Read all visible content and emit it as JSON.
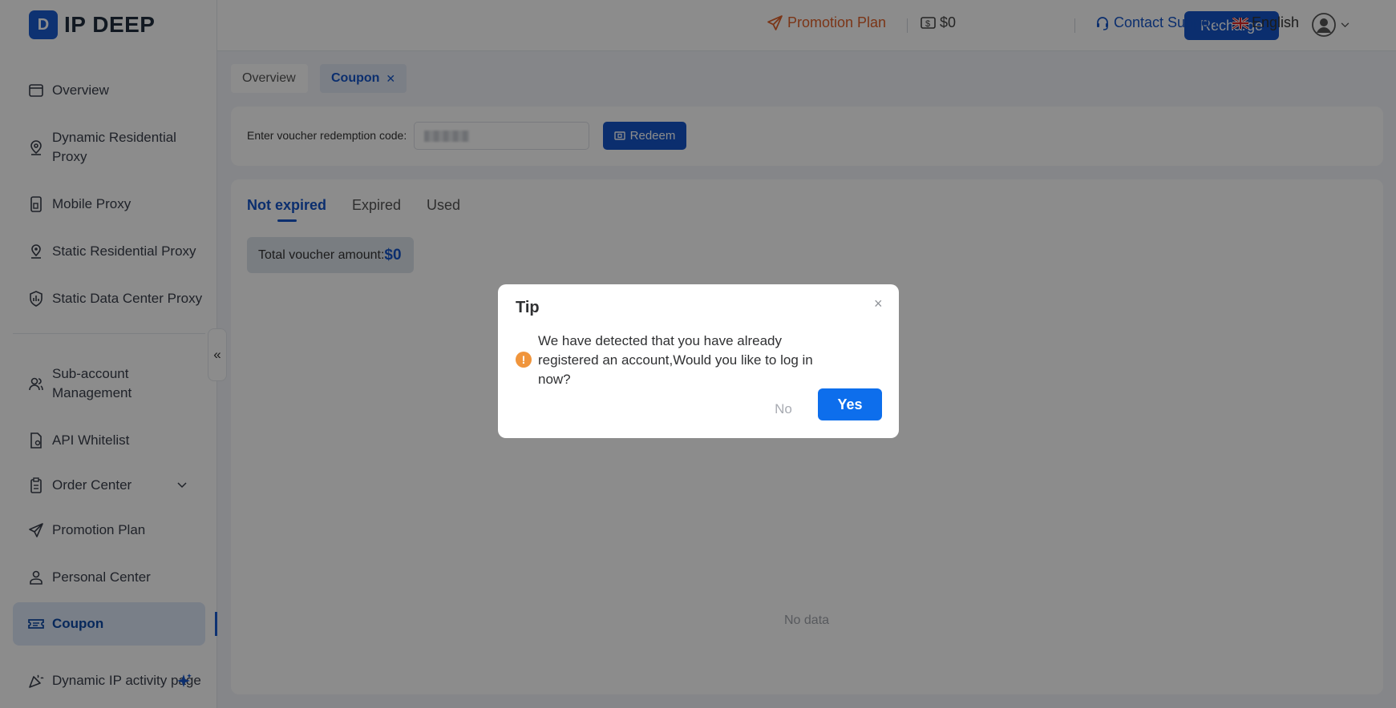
{
  "brand": {
    "logo_letter": "D",
    "name": "IP DEEP",
    "accent": "#1455c8"
  },
  "sidebar": {
    "items": [
      {
        "label": "Overview",
        "icon": "window-icon"
      },
      {
        "label": "Dynamic Residential Proxy",
        "icon": "location-pin-icon"
      },
      {
        "label": "Mobile Proxy",
        "icon": "mobile-icon"
      },
      {
        "label": "Static Residential Proxy",
        "icon": "pin-icon"
      },
      {
        "label": "Static Data Center Proxy",
        "icon": "shield-chart-icon"
      },
      {
        "label": "Sub-account Management",
        "icon": "users-icon"
      },
      {
        "label": "API Whitelist",
        "icon": "document-check-icon"
      },
      {
        "label": "Order Center",
        "icon": "clipboard-icon"
      },
      {
        "label": "Promotion Plan",
        "icon": "send-icon"
      },
      {
        "label": "Personal Center",
        "icon": "user-icon"
      },
      {
        "label": "Coupon",
        "icon": "ticket-icon"
      },
      {
        "label": "Dynamic IP activity page",
        "icon": "party-icon"
      }
    ],
    "active": "Coupon",
    "collapse_glyph": "«"
  },
  "header": {
    "promotion": "Promotion Plan",
    "balance": "$0",
    "recharge": "Recharge",
    "support": "Contact Support",
    "language": "English"
  },
  "tabs": {
    "overview": "Overview",
    "coupon": "Coupon",
    "close": "✕"
  },
  "redeem": {
    "label": "Enter voucher redemption code:",
    "button": "Redeem"
  },
  "voucher_tabs": {
    "not_expired": "Not expired",
    "expired": "Expired",
    "used": "Used"
  },
  "total": {
    "label": "Total voucher amount:",
    "amount": "$0"
  },
  "empty": "No data",
  "modal": {
    "title": "Tip",
    "message": "We have detected that you have already registered an account,Would you like to log in now?",
    "no": "No",
    "yes": "Yes",
    "close": "×",
    "warn": "!"
  }
}
